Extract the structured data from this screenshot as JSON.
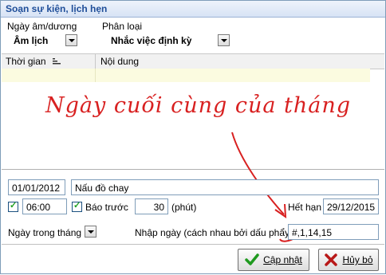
{
  "window": {
    "title": "Soạn sự kiện, lịch hẹn"
  },
  "calendar": {
    "label": "Ngày âm/dương",
    "value": "Âm lịch"
  },
  "category": {
    "label": "Phân loại",
    "value": "Nhắc việc định kỳ"
  },
  "grid": {
    "columns": [
      "Thời gian",
      "Nội dung"
    ]
  },
  "annotation": {
    "text": "Ngày cuối cùng của tháng"
  },
  "form": {
    "date": "01/01/2012",
    "content": "Nấu đồ chay",
    "time": "06:00",
    "remind_label": "Báo trước",
    "remind_value": "30",
    "remind_unit": "(phút)",
    "expire_label": "Hết hạn",
    "expire_value": "29/12/2015",
    "day_mode": "Ngày trong tháng",
    "input_days_label": "Nhập ngày (cách nhau bởi dấu phẩy)",
    "input_days_value": "#,1,14,15"
  },
  "buttons": {
    "update": "Cập nhật",
    "cancel": "Hủy bỏ"
  },
  "colors": {
    "annotation": "#d82020",
    "title": "#1f4e99",
    "row_highlight": "#fbfbe0"
  }
}
